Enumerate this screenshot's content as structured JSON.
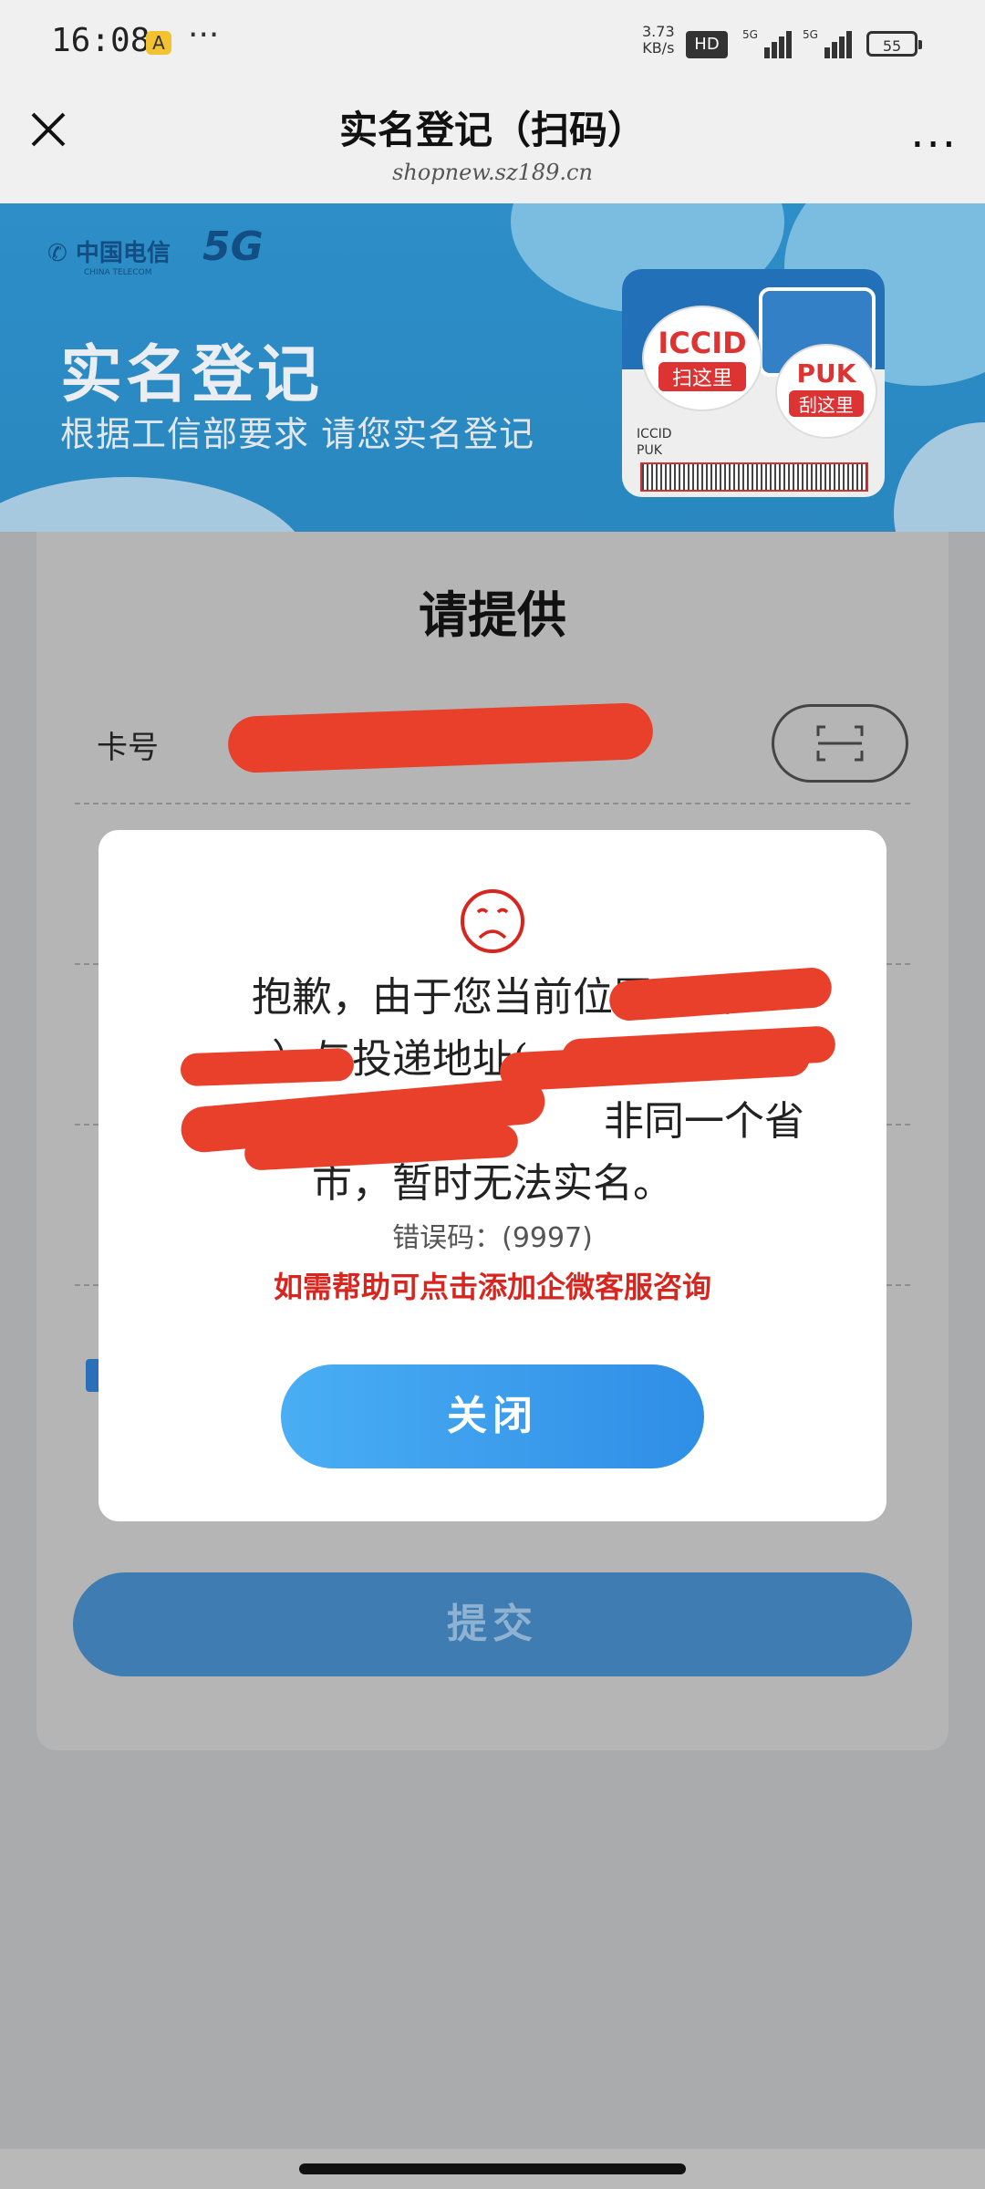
{
  "status_bar": {
    "time": "16:08",
    "app_icon": "A",
    "more": "···",
    "net_speed_value": "3.73",
    "net_speed_unit": "KB/s",
    "hd": "HD",
    "signal_1_label": "5G",
    "signal_2_label": "5G",
    "battery": "55"
  },
  "navbar": {
    "title": "实名登记（扫码）",
    "url": "shopnew.sz189.cn",
    "more": "···"
  },
  "banner": {
    "brand": "中国电信",
    "brand_en": "CHINA TELECOM",
    "brand_5g": "5G",
    "title": "实名登记",
    "subtitle": "根据工信部要求 请您实名登记",
    "sim": {
      "iccid": "ICCID",
      "iccid_tag": "扫这里",
      "puk": "PUK",
      "puk_tag": "刮这里",
      "label_iccid": "ICCID",
      "label_puk": "PUK"
    }
  },
  "form": {
    "heading": "请提供",
    "card_label": "卡号",
    "submit_label": "提交"
  },
  "modal": {
    "line1": "抱歉，由于您当前位置（山",
    "line2": "）与投递地址(",
    "line3": "非同一个省",
    "line4": "市，暂时无法实名。",
    "error_code": "错误码：(9997)",
    "help_text": "如需帮助可点击添加企微客服咨询",
    "close_label": "关闭"
  },
  "colors": {
    "accent_blue": "#2f8ee6",
    "error_red": "#d6261f",
    "banner_blue": "#2d8ec8"
  }
}
